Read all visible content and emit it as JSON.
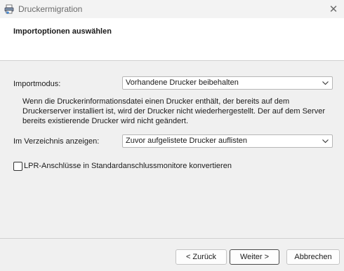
{
  "window": {
    "title": "Druckermigration",
    "close_glyph": "✕",
    "icon": "printer-migration-icon"
  },
  "header": {
    "title": "Importoptionen auswählen"
  },
  "import_mode": {
    "label": "Importmodus:",
    "selected": "Vorhandene Drucker beibehalten",
    "description": "Wenn die Druckerinformationsdatei einen Drucker enthält, der bereits auf dem Druckerserver installiert ist, wird der Drucker nicht wiederhergestellt. Der auf dem Server bereits existierende Drucker wird nicht geändert."
  },
  "directory": {
    "label": "Im Verzeichnis anzeigen:",
    "selected": "Zuvor aufgelistete Drucker auflisten"
  },
  "lpr": {
    "label": "LPR-Anschlüsse in Standardanschlussmonitore konvertieren",
    "checked": false
  },
  "buttons": {
    "back": "< Zurück",
    "next": "Weiter >",
    "cancel": "Abbrechen"
  }
}
